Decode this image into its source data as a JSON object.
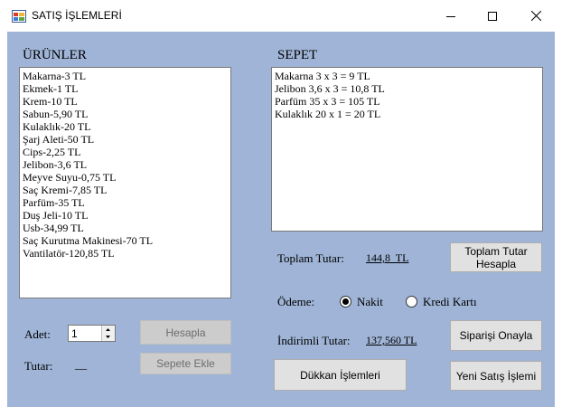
{
  "window": {
    "title": "SATIŞ İŞLEMLERİ"
  },
  "urunler": {
    "title": "ÜRÜNLER",
    "items": [
      "Makarna-3 TL",
      "Ekmek-1 TL",
      "Krem-10 TL",
      "Sabun-5,90 TL",
      "Kulaklık-20 TL",
      "Şarj Aleti-50 TL",
      "Cips-2,25 TL",
      "Jelibon-3,6 TL",
      "Meyve Suyu-0,75 TL",
      "Saç Kremi-7,85 TL",
      "Parfüm-35 TL",
      "Duş Jeli-10 TL",
      "Usb-34,99 TL",
      "Saç Kurutma Makinesi-70 TL",
      "Vantilatör-120,85 TL"
    ]
  },
  "sepet": {
    "title": "SEPET",
    "items": [
      "Makarna 3 x 3 = 9 TL",
      "Jelibon 3,6 x 3 = 10,8 TL",
      "Parfüm 35 x 3 = 105 TL",
      "Kulaklık 20 x 1 = 20 TL"
    ]
  },
  "adet": {
    "label": "Adet:",
    "value": "1"
  },
  "tutar": {
    "label": "Tutar:",
    "value": "__"
  },
  "buttons": {
    "hesapla": "Hesapla",
    "sepete_ekle": "Sepete Ekle",
    "dukkan": "Dükkan İşlemleri",
    "toplam_tutar_hesapla_1": "Toplam Tutar",
    "toplam_tutar_hesapla_2": "Hesapla",
    "siparisi_onayla": "Siparişi Onayla",
    "yeni_satis": "Yeni Satış İşlemi"
  },
  "toplam": {
    "label": "Toplam Tutar:",
    "value": "144,8  TL"
  },
  "odeme": {
    "label": "Ödeme:",
    "options": [
      "Nakit",
      "Kredi Kartı"
    ],
    "selected": "Nakit"
  },
  "indirimli": {
    "label": "İndirimli Tutar:",
    "value": "137,560 TL"
  }
}
